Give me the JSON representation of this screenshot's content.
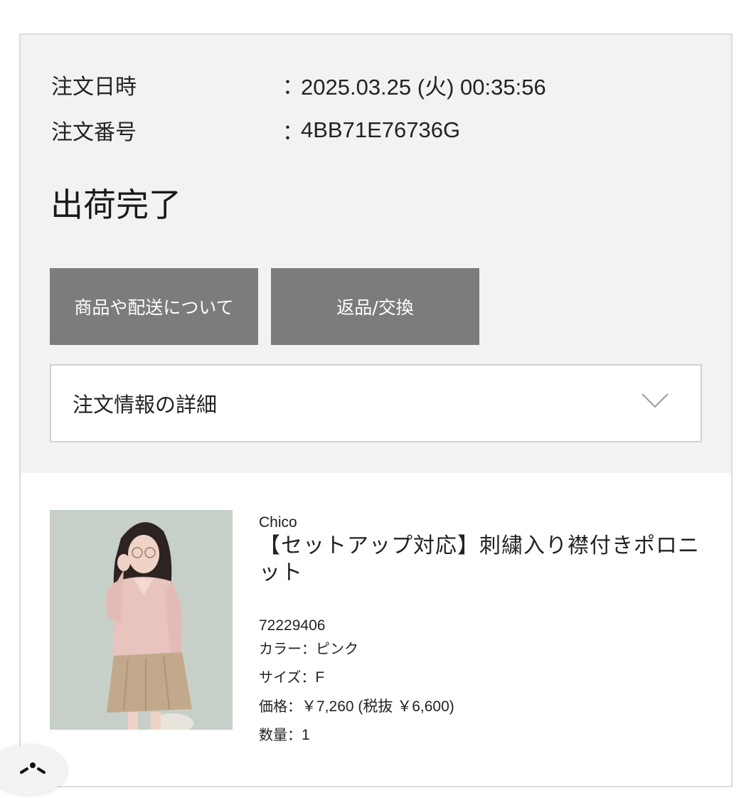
{
  "order": {
    "date_label": "注文日時",
    "date_colon": "：",
    "date_value": "2025.03.25 (火) 00:35:56",
    "number_label": "注文番号",
    "number_colon": "：",
    "number_value": "4BB71E76736G"
  },
  "status": "出荷完了",
  "buttons": {
    "product_delivery": "商品や配送について",
    "return_exchange": "返品/交換"
  },
  "accordion": {
    "label": "注文情報の詳細",
    "icon": "chevron-down-icon"
  },
  "product": {
    "brand": "Chico",
    "name": "【セットアップ対応】刺繍入り襟付きポロニット",
    "code": "72229406",
    "color_label": "カラー：",
    "color_value": "ピンク",
    "size_label": "サイズ：",
    "size_value": "F",
    "price_label": "価格：",
    "price_value": "￥7,260 (税抜 ￥6,600)",
    "qty_label": "数量：",
    "qty_value": "1",
    "image_alt": "model wearing pink polo knit and beige pleated skirt"
  },
  "colors": {
    "panel_bg": "#f2f2f2",
    "button_bg": "#7c7c7c",
    "button_text": "#ffffff",
    "product_pink": "#e9c3be",
    "skirt_beige": "#c2a98b"
  }
}
